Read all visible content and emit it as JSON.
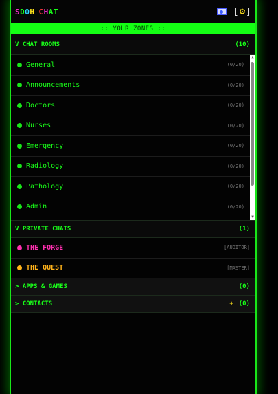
{
  "app": {
    "title_letters": [
      {
        "ch": "S",
        "color": "#ff2fd2"
      },
      {
        "ch": "D",
        "color": "#19ff19"
      },
      {
        "ch": "O",
        "color": "#2bd6ff"
      },
      {
        "ch": "H",
        "color": "#ffe21a"
      },
      {
        "ch": " ",
        "color": "#ffffff"
      },
      {
        "ch": "C",
        "color": "#ff3a3a"
      },
      {
        "ch": "H",
        "color": "#ff2fd2"
      },
      {
        "ch": "A",
        "color": "#19ff19"
      },
      {
        "ch": "T",
        "color": "#19ff19"
      }
    ],
    "settings_open": "[",
    "settings_close": "]"
  },
  "zones_label": ":: YOUR ZONES ::",
  "chat_rooms": {
    "header": "V CHAT ROOMS",
    "count": "(10)",
    "items": [
      {
        "label": "General",
        "count": "(0/20)"
      },
      {
        "label": "Announcements",
        "count": "(0/20)"
      },
      {
        "label": "Doctors",
        "count": "(0/20)"
      },
      {
        "label": "Nurses",
        "count": "(0/20)"
      },
      {
        "label": "Emergency",
        "count": "(0/20)"
      },
      {
        "label": "Radiology",
        "count": "(0/20)"
      },
      {
        "label": "Pathology",
        "count": "(0/20)"
      },
      {
        "label": "Admin",
        "count": "(0/20)"
      }
    ]
  },
  "private_chats": {
    "header": "V PRIVATE CHATS",
    "count": "(1)",
    "items": [
      {
        "label": "THE FORGE",
        "role": "[AUDITOR]",
        "color": "#ff2fb0"
      },
      {
        "label": "THE QUEST",
        "role": "[MASTER]",
        "color": "#ffb21a"
      }
    ]
  },
  "apps_games": {
    "header": "> APPS & GAMES",
    "count": "(0)"
  },
  "contacts": {
    "header": "> CONTACTS",
    "plus": "+",
    "count": "(0)"
  },
  "colors": {
    "accent": "#19ff19",
    "bullet_green": "#19e619"
  }
}
